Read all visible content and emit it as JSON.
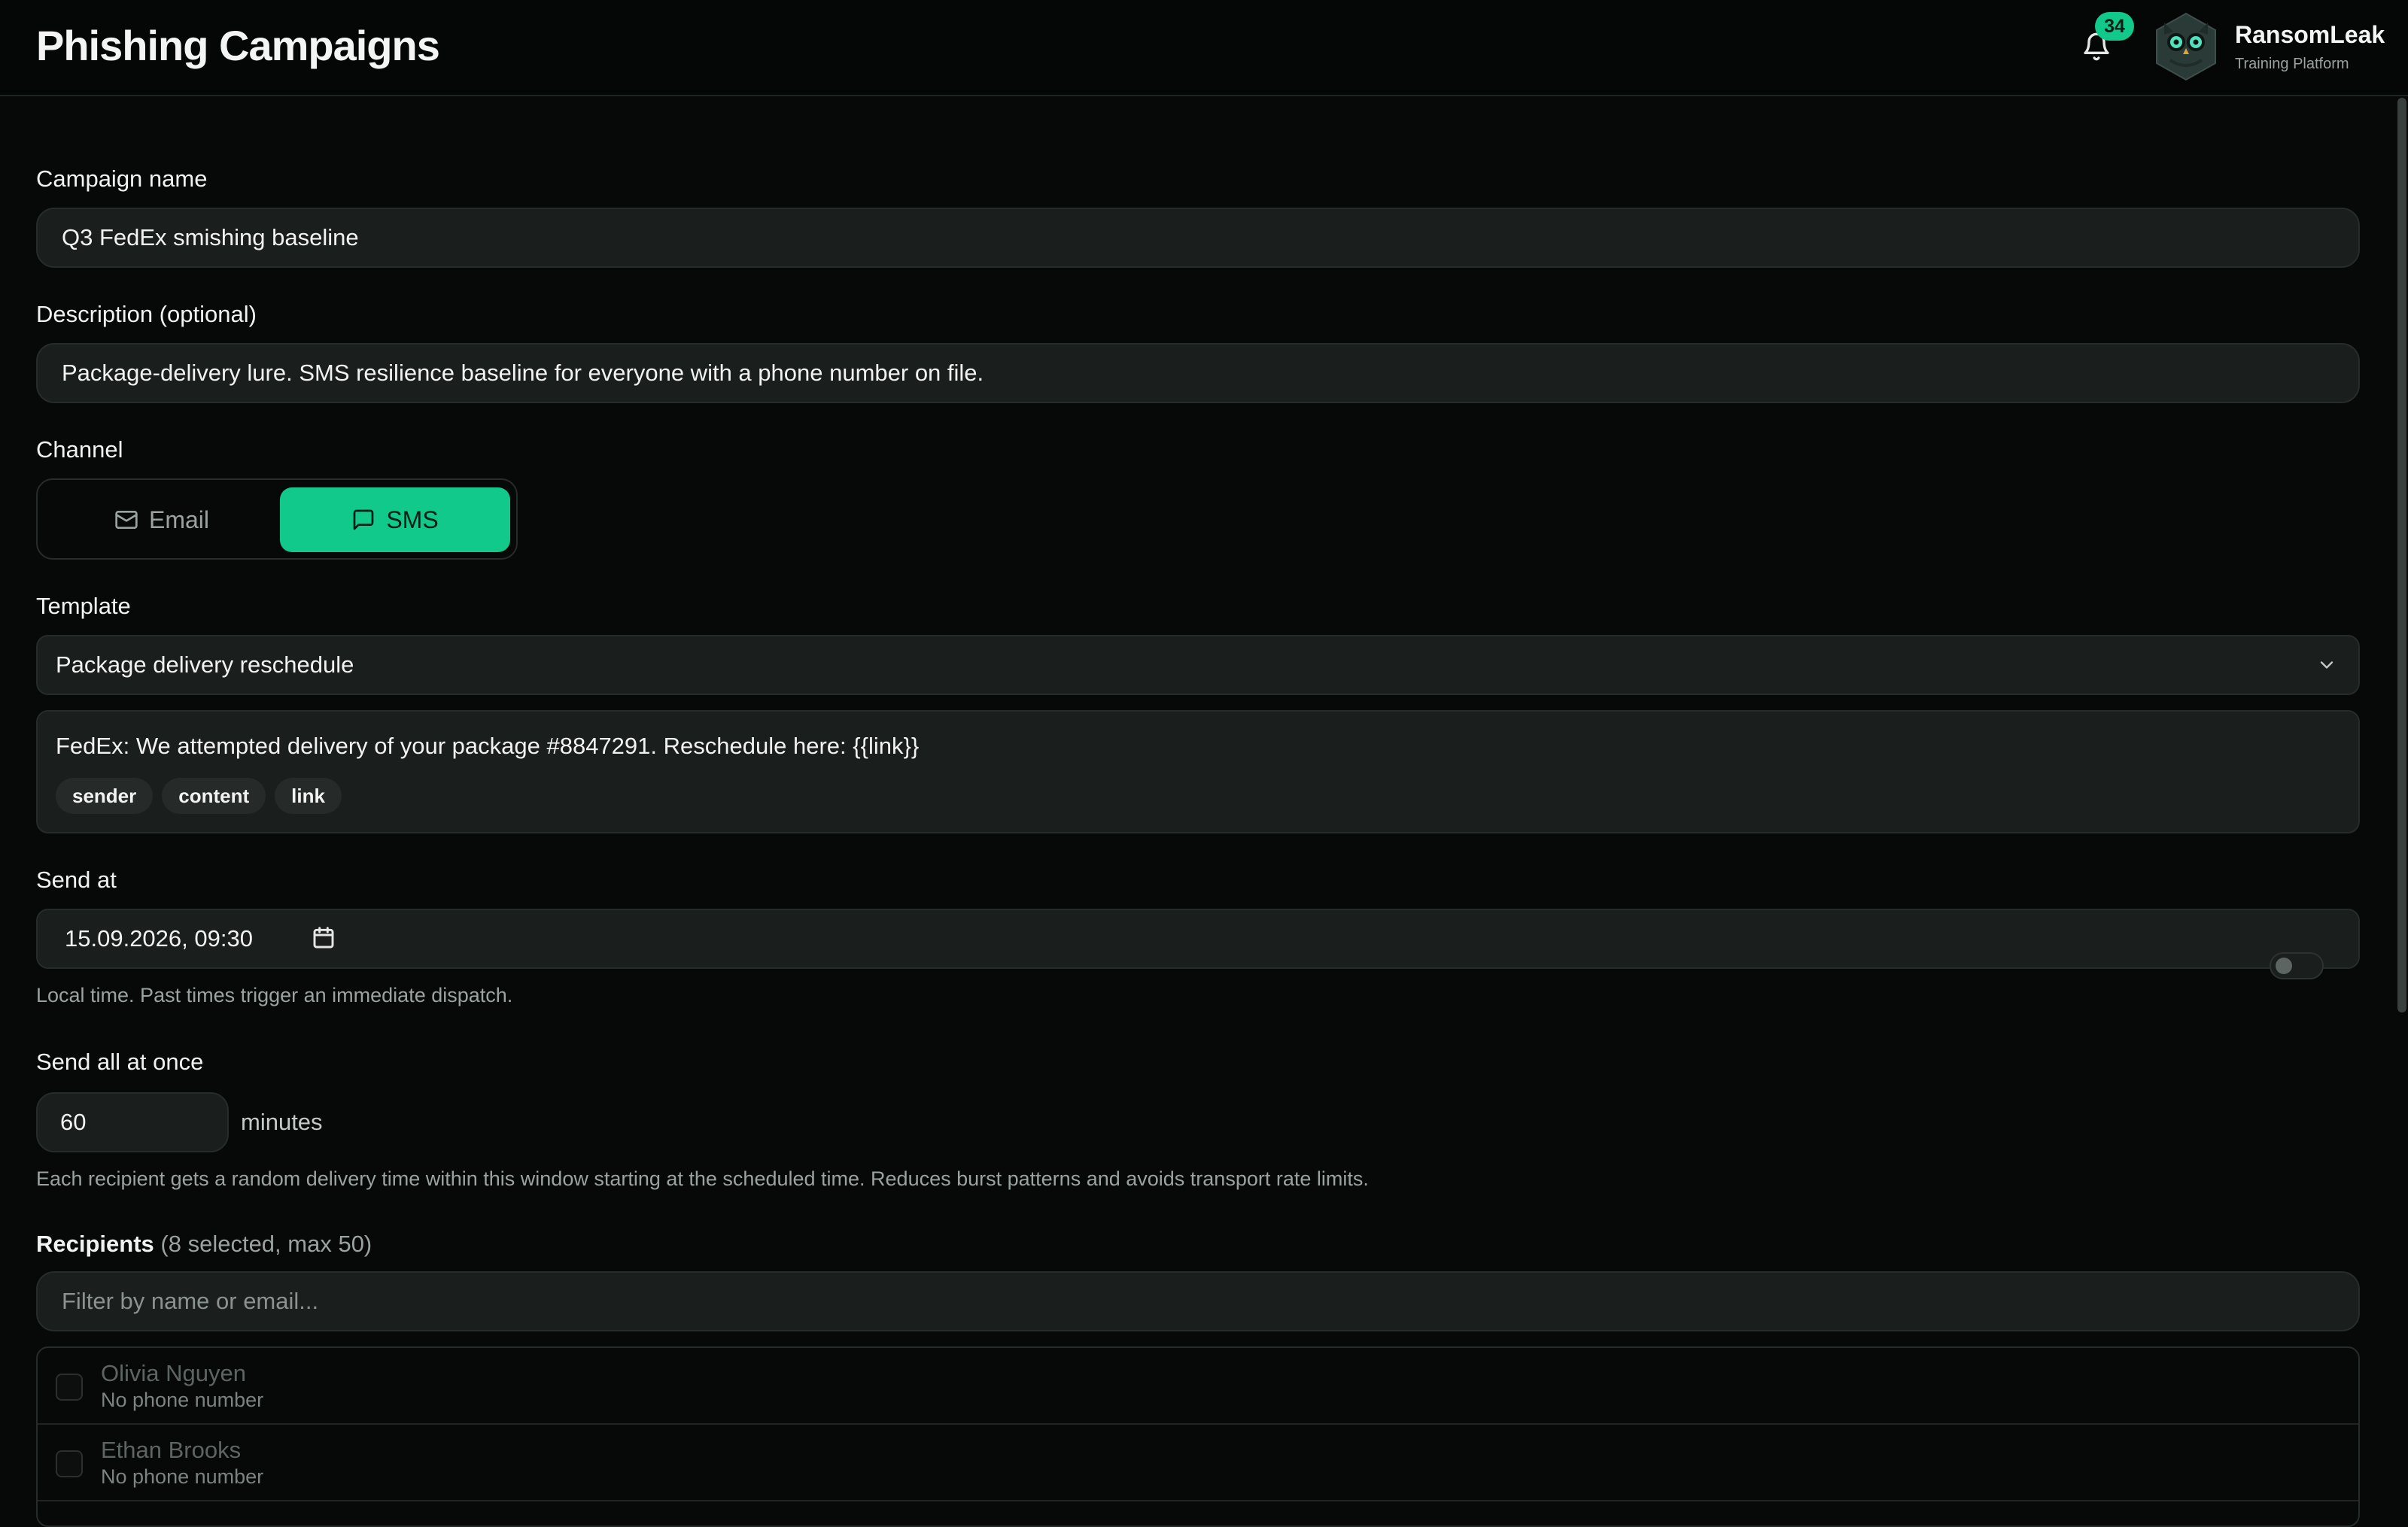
{
  "header": {
    "title": "Phishing Campaigns",
    "notifications_count": "34",
    "brand_name": "RansomLeak",
    "brand_subtitle": "Training Platform"
  },
  "form": {
    "campaign_name": {
      "label": "Campaign name",
      "value": "Q3 FedEx smishing baseline"
    },
    "description": {
      "label": "Description (optional)",
      "value": "Package-delivery lure. SMS resilience baseline for everyone with a phone number on file."
    },
    "channel": {
      "label": "Channel",
      "options": [
        "Email",
        "SMS"
      ],
      "selected": "SMS"
    },
    "template": {
      "label": "Template",
      "selected": "Package delivery reschedule",
      "preview": "FedEx: We attempted delivery of your package #8847291. Reschedule here: {{link}}",
      "tags": [
        "sender",
        "content",
        "link"
      ]
    },
    "send_at": {
      "label": "Send at",
      "value": "15.09.2026, 09:30",
      "helper": "Local time. Past times trigger an immediate dispatch."
    },
    "send_all_at_once": {
      "label": "Send all at once",
      "enabled": false,
      "window_value": "60",
      "window_unit": "minutes",
      "helper": "Each recipient gets a random delivery time within this window starting at the scheduled time. Reduces burst patterns and avoids transport rate limits."
    },
    "recipients": {
      "label": "Recipients",
      "count_text": "(8 selected, max 50)",
      "filter_placeholder": "Filter by name or email...",
      "items": [
        {
          "name": "Olivia Nguyen",
          "detail": "No phone number"
        },
        {
          "name": "Ethan Brooks",
          "detail": "No phone number"
        }
      ]
    }
  },
  "colors": {
    "accent": "#10c98a",
    "background": "#070908",
    "field": "#1a1e1d"
  }
}
